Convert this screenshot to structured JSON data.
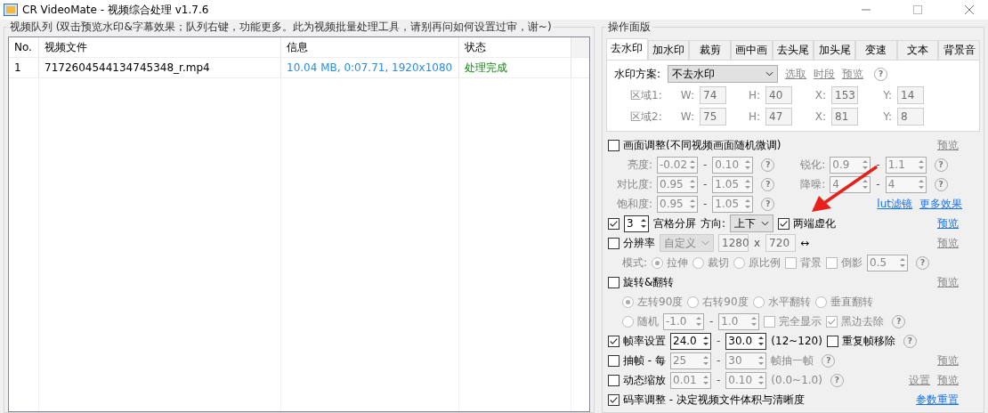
{
  "window": {
    "title": "CR VideoMate - 视频综合处理 v1.7.6"
  },
  "queue": {
    "title": "视频队列 (双击预览水印&字幕效果；队列右键，功能更多。此为视频批量处理工具，请别再问如何设置过审，谢~)",
    "columns": [
      "No.",
      "视频文件",
      "信息",
      "状态"
    ],
    "rows": [
      {
        "no": "1",
        "file": "7172604544134745348_r.mp4",
        "info": "10.04 MB, 0:07.71, 1920x1080",
        "status": "处理完成"
      }
    ]
  },
  "panel": {
    "title": "操作面版",
    "tabs": [
      {
        "label": "去水印",
        "selected": true
      },
      {
        "label": "加水印",
        "selected": false
      },
      {
        "label": "裁剪",
        "selected": false
      },
      {
        "label": "画中画",
        "selected": false
      },
      {
        "label": "去头尾",
        "selected": false
      },
      {
        "label": "加头尾",
        "selected": false
      },
      {
        "label": "变速",
        "selected": false
      },
      {
        "label": "文本",
        "selected": false
      },
      {
        "label": "背景音",
        "selected": false
      }
    ],
    "watermark": {
      "label": "水印方案:",
      "scheme": "不去水印",
      "help": "?",
      "links": [
        {
          "text": "选取",
          "disabled": true
        },
        {
          "text": "时段",
          "disabled": true
        },
        {
          "text": "预览",
          "disabled": true
        }
      ],
      "regions": [
        {
          "label": "区域1:",
          "fields": [
            {
              "label": "W:",
              "value": "74"
            },
            {
              "label": "H:",
              "value": "40"
            },
            {
              "label": "X:",
              "value": "153"
            },
            {
              "label": "Y:",
              "value": "14"
            }
          ]
        },
        {
          "label": "区域2:",
          "fields": [
            {
              "label": "W:",
              "value": "75"
            },
            {
              "label": "H:",
              "value": "47"
            },
            {
              "label": "X:",
              "value": "81"
            },
            {
              "label": "Y:",
              "value": "8"
            }
          ]
        }
      ]
    },
    "rows": [
      {
        "kind": "main",
        "items": [
          {
            "kind": "check",
            "label": "画面调整(不同视频画面随机微调)",
            "checked": false,
            "disabled": false
          }
        ],
        "links": [
          {
            "text": "预览",
            "disabled": true
          }
        ]
      },
      {
        "kind": "grid",
        "items": [
          {
            "kind": "label",
            "text": "亮度:"
          },
          {
            "kind": "spin",
            "value": "-0.02",
            "disabled": true
          },
          {
            "kind": "sep",
            "text": "-"
          },
          {
            "kind": "spin",
            "value": "0.10",
            "disabled": true
          },
          {
            "kind": "help",
            "text": "?"
          },
          {
            "kind": "label",
            "text": "锐化:"
          },
          {
            "kind": "spin",
            "value": "0.9",
            "disabled": true
          },
          {
            "kind": "sep",
            "text": "-"
          },
          {
            "kind": "spin",
            "value": "1.1",
            "disabled": true
          },
          {
            "kind": "help",
            "text": "?"
          }
        ]
      },
      {
        "kind": "grid",
        "items": [
          {
            "kind": "label",
            "text": "对比度:"
          },
          {
            "kind": "spin",
            "value": "0.95",
            "disabled": true
          },
          {
            "kind": "sep",
            "text": "-"
          },
          {
            "kind": "spin",
            "value": "1.05",
            "disabled": true
          },
          {
            "kind": "help",
            "text": "?"
          },
          {
            "kind": "label",
            "text": "降噪:"
          },
          {
            "kind": "spin",
            "value": "4",
            "disabled": true
          },
          {
            "kind": "sep",
            "text": "-"
          },
          {
            "kind": "spin",
            "value": "4",
            "disabled": true
          },
          {
            "kind": "help",
            "text": "?"
          }
        ]
      },
      {
        "kind": "grid",
        "items": [
          {
            "kind": "label",
            "text": "饱和度:"
          },
          {
            "kind": "spin",
            "value": "0.95",
            "disabled": true
          },
          {
            "kind": "sep",
            "text": "-"
          },
          {
            "kind": "spin",
            "value": "1.05",
            "disabled": true
          },
          {
            "kind": "help",
            "text": "?"
          }
        ],
        "links": [
          {
            "text": "lut滤镜",
            "disabled": false
          },
          {
            "text": "更多效果",
            "disabled": false
          }
        ]
      },
      {
        "kind": "main",
        "items": [
          {
            "kind": "check",
            "checked": true,
            "disabled": false
          },
          {
            "kind": "count",
            "value": "3",
            "disabled": false
          },
          {
            "kind": "text",
            "text": "宫格分屏",
            "disabled": false
          },
          {
            "kind": "text",
            "text": "方向:",
            "disabled": false
          },
          {
            "kind": "select",
            "value": "上下",
            "disabled": false
          },
          {
            "kind": "check",
            "label": "两端虚化",
            "checked": true,
            "disabled": false
          }
        ],
        "links": [
          {
            "text": "预览",
            "disabled": false
          }
        ]
      },
      {
        "kind": "main",
        "items": [
          {
            "kind": "check",
            "label": "分辨率",
            "checked": false,
            "disabled": false
          },
          {
            "kind": "select",
            "value": "自定义",
            "disabled": true
          },
          {
            "kind": "input",
            "value": "1280",
            "disabled": true
          },
          {
            "kind": "sep",
            "text": "x"
          },
          {
            "kind": "input",
            "value": "720",
            "disabled": true
          },
          {
            "kind": "text",
            "text": "↔",
            "disabled": false
          }
        ],
        "links": [
          {
            "text": "预览",
            "disabled": true
          }
        ]
      },
      {
        "kind": "sub",
        "items": [
          {
            "kind": "text",
            "text": "模式:",
            "disabled": true
          },
          {
            "kind": "radio",
            "label": "拉伸",
            "selected": true,
            "disabled": true
          },
          {
            "kind": "radio",
            "label": "裁切",
            "selected": false,
            "disabled": true
          },
          {
            "kind": "radio",
            "label": "原比例",
            "selected": false,
            "disabled": true
          },
          {
            "kind": "check",
            "label": "背景",
            "checked": false,
            "disabled": true
          },
          {
            "kind": "check",
            "label": "倒影",
            "checked": false,
            "disabled": true
          },
          {
            "kind": "spin",
            "value": "0.5",
            "disabled": true
          },
          {
            "kind": "help",
            "text": "?"
          }
        ]
      },
      {
        "kind": "main",
        "items": [
          {
            "kind": "check",
            "label": "旋转&翻转",
            "checked": false,
            "disabled": false
          }
        ],
        "links": [
          {
            "text": "预览",
            "disabled": true
          }
        ]
      },
      {
        "kind": "sub",
        "items": [
          {
            "kind": "radio",
            "label": "左转90度",
            "selected": true,
            "disabled": true
          },
          {
            "kind": "radio",
            "label": "右转90度",
            "selected": false,
            "disabled": true
          },
          {
            "kind": "radio",
            "label": "水平翻转",
            "selected": false,
            "disabled": true
          },
          {
            "kind": "radio",
            "label": "垂直翻转",
            "selected": false,
            "disabled": true
          }
        ]
      },
      {
        "kind": "sub",
        "items": [
          {
            "kind": "radio",
            "label": "随机",
            "selected": false,
            "disabled": true
          },
          {
            "kind": "spin",
            "value": "-1.0",
            "disabled": true
          },
          {
            "kind": "sep",
            "text": "-"
          },
          {
            "kind": "spin",
            "value": "1.0",
            "disabled": true
          },
          {
            "kind": "check",
            "label": "完全显示",
            "checked": false,
            "disabled": true
          },
          {
            "kind": "check",
            "label": "黑边去除",
            "checked": true,
            "disabled": true
          },
          {
            "kind": "help",
            "text": "?"
          }
        ]
      },
      {
        "kind": "main",
        "items": [
          {
            "kind": "check",
            "label": "帧率设置",
            "checked": true,
            "disabled": false
          },
          {
            "kind": "spin",
            "value": "24.0",
            "disabled": false
          },
          {
            "kind": "sep",
            "text": "-"
          },
          {
            "kind": "spin",
            "value": "30.0",
            "disabled": false
          },
          {
            "kind": "text",
            "text": "(12~120)",
            "disabled": false
          },
          {
            "kind": "check",
            "label": "重复帧移除",
            "checked": false,
            "disabled": false
          },
          {
            "kind": "help",
            "text": "?"
          }
        ]
      },
      {
        "kind": "main",
        "items": [
          {
            "kind": "check",
            "label": "抽帧 - 每",
            "checked": false,
            "disabled": false
          },
          {
            "kind": "spin",
            "value": "25",
            "disabled": true
          },
          {
            "kind": "sep",
            "text": "-"
          },
          {
            "kind": "spin",
            "value": "30",
            "disabled": true
          },
          {
            "kind": "text",
            "text": "帧抽一帧",
            "disabled": true
          },
          {
            "kind": "help",
            "text": "?"
          }
        ],
        "links": [
          {
            "text": "预览",
            "disabled": true
          }
        ]
      },
      {
        "kind": "main",
        "items": [
          {
            "kind": "check",
            "label": "动态缩放",
            "checked": false,
            "disabled": false
          },
          {
            "kind": "spin",
            "value": "0.01",
            "disabled": true
          },
          {
            "kind": "sep",
            "text": "-"
          },
          {
            "kind": "spin",
            "value": "0.10",
            "disabled": true
          },
          {
            "kind": "text",
            "text": "(0.0~1.0)",
            "disabled": true
          },
          {
            "kind": "help",
            "text": "?"
          }
        ],
        "links": [
          {
            "text": "设置",
            "disabled": true
          },
          {
            "text": "预览",
            "disabled": true
          }
        ]
      },
      {
        "kind": "main",
        "items": [
          {
            "kind": "check",
            "label": "码率调整 - 决定视频文件体积与清晰度",
            "checked": true,
            "disabled": false
          }
        ],
        "links": [
          {
            "text": "参数重置",
            "disabled": false
          }
        ]
      }
    ]
  }
}
